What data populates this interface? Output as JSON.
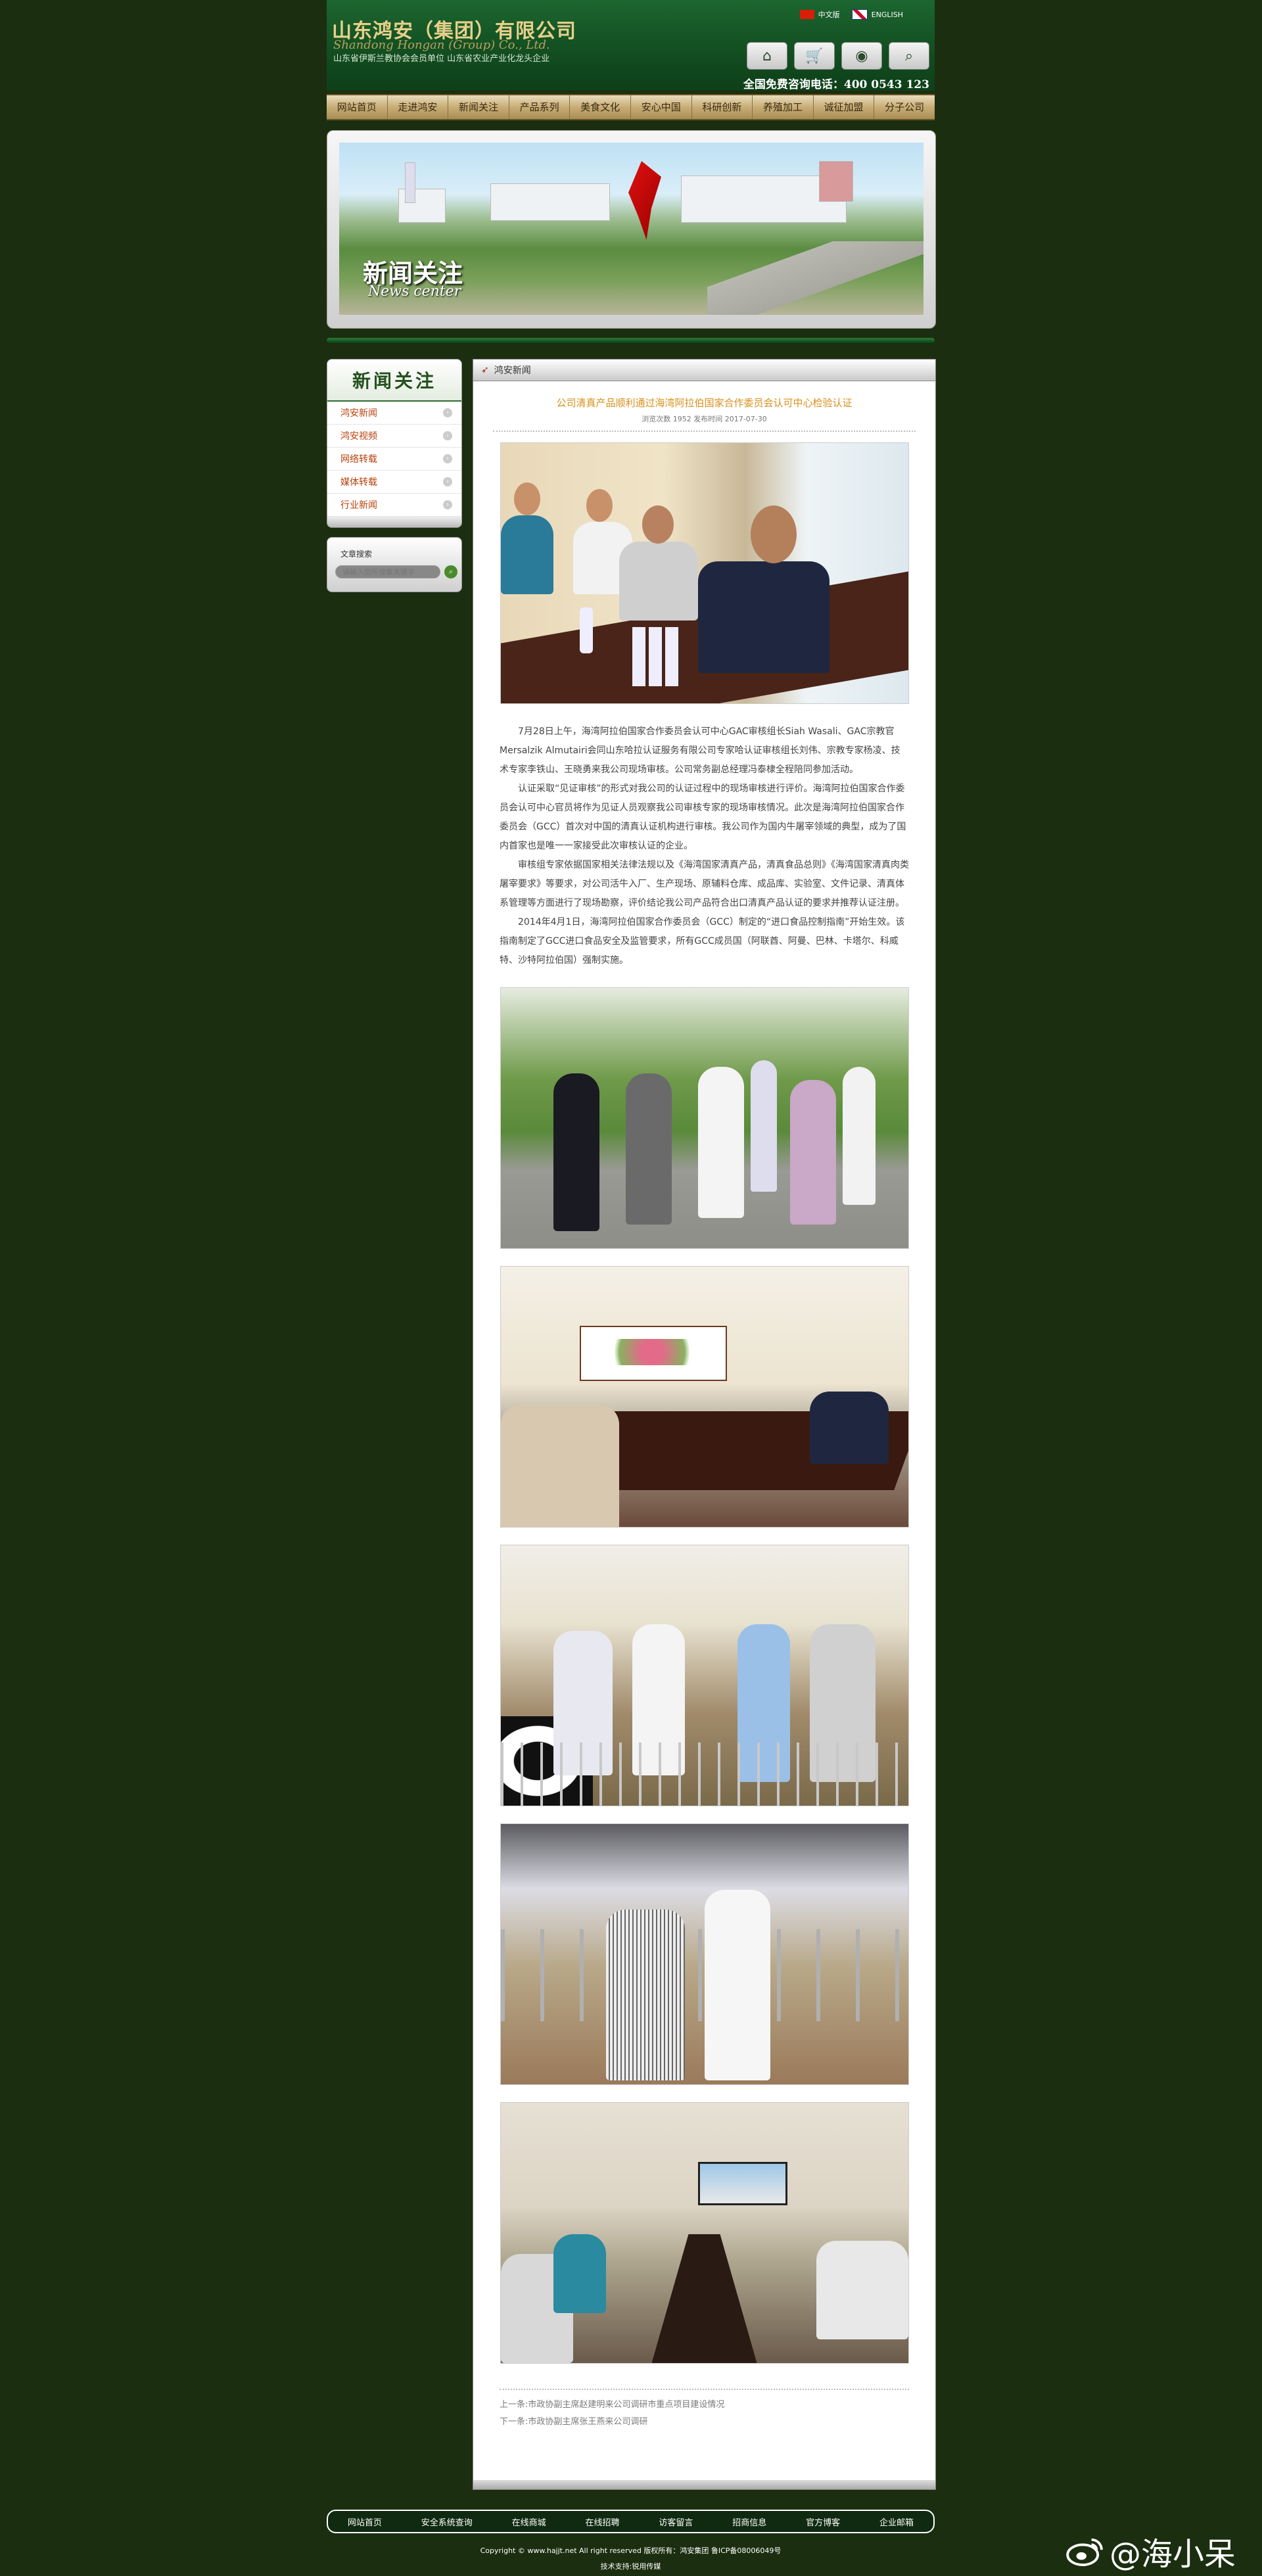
{
  "header": {
    "logo_cn": "山东鸿安（集团）有限公司",
    "logo_en": "Shandong Hongan (Group) Co., Ltd.",
    "logo_sub": "山东省伊斯兰教协会会员单位  山东省农业产业化龙头企业",
    "lang_cn": "中文版",
    "lang_en": "ENGLISH",
    "hotline": "全国免费咨询电话：400 0543 123",
    "tools": [
      "home-icon",
      "cart-icon",
      "chat-icon",
      "search-icon"
    ]
  },
  "nav": [
    "网站首页",
    "走进鸿安",
    "新闻关注",
    "产品系列",
    "美食文化",
    "安心中国",
    "科研创新",
    "养殖加工",
    "诚征加盟",
    "分子公司"
  ],
  "banner": {
    "title": "新闻关注",
    "subtitle": "News center"
  },
  "sidebar": {
    "heading": "新闻关注",
    "items": [
      "鸿安新闻",
      "鸿安视频",
      "网络转载",
      "媒体转载",
      "行业新闻"
    ],
    "search_title": "文章搜索",
    "search_placeholder": "请输入您所搜索关键字"
  },
  "main": {
    "section": "鸿安新闻",
    "title": "公司清真产品顺利通过海湾阿拉伯国家合作委员会认可中心检验认证",
    "meta": "浏览次数 1952    发布时间 2017-07-30",
    "paragraphs": [
      "7月28日上午，海湾阿拉伯国家合作委员会认可中心GAC审核组长Siah Wasali、GAC宗教官Mersalzik Almutairi会同山东哈拉认证服务有限公司专家哈认证审核组长刘伟、宗教专家杨凌、技术专家李铁山、王晓勇来我公司现场审核。公司常务副总经理冯泰棣全程陪同参加活动。",
      "认证采取“见证审核”的形式对我公司的认证过程中的现场审核进行评价。海湾阿拉伯国家合作委员会认可中心官员将作为见证人员观察我公司审核专家的现场审核情况。此次是海湾阿拉伯国家合作委员会（GCC）首次对中国的清真认证机构进行审核。我公司作为国内牛屠宰领域的典型，成为了国内首家也是唯一一家接受此次审核认证的企业。",
      "审核组专家依据国家相关法律法规以及《海湾国家清真产品，清真食品总则》《海湾国家清真肉类屠宰要求》等要求，对公司活牛入厂、生产现场、原辅料仓库、成品库、实验室、文件记录、清真体系管理等方面进行了现场勘察，评价结论我公司产品符合出口清真产品认证的要求并推荐认证注册。",
      "2014年4月1日，海湾阿拉伯国家合作委员会（GCC）制定的“进口食品控制指南”开始生效。该指南制定了GCC进口食品安全及监管要求，所有GCC成员国（阿联酋、阿曼、巴林、卡塔尔、科威特、沙特阿拉伯国）强制实施。"
    ],
    "prev": "上一条:市政协副主席赵建明来公司调研市重点项目建设情况",
    "next": "下一条:市政协副主席张王燕来公司调研"
  },
  "footer": {
    "links": [
      "网站首页",
      "安全系统查询",
      "在线商城",
      "在线招聘",
      "访客留言",
      "招商信息",
      "官方博客",
      "企业邮箱"
    ],
    "copyright": "Copyright © www.hajjt.net  All right reserved  版权所有：鸿安集团  鲁ICP备08006049号",
    "tech": "技术支持:锐用传媒"
  },
  "watermark": "@海小呆",
  "colors": {
    "page_bg": "#1b2e10",
    "header_green": "#124d20",
    "accent_orange": "#d8901a",
    "nav_gold": "#c8ad76"
  }
}
